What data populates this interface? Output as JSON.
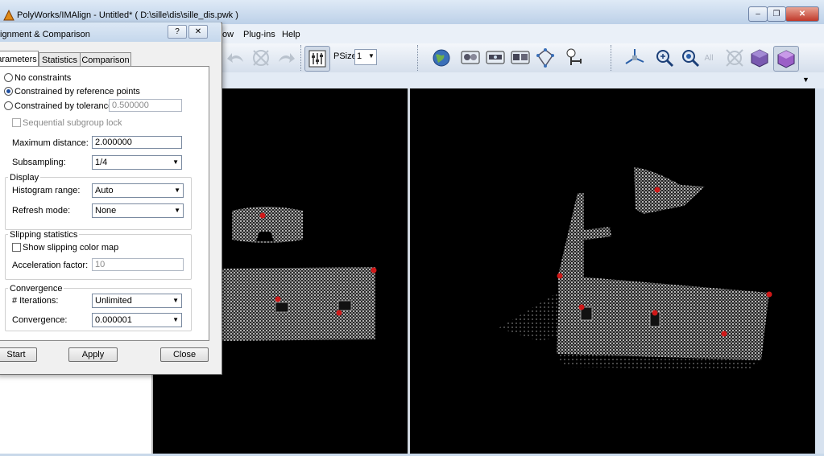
{
  "window": {
    "title": "PolyWorks/IMAlign - Untitled* ( D:\\sille\\dis\\sille_dis.pwk )",
    "minimize_glyph": "‒",
    "restore_glyph": "❐",
    "close_glyph": "✕"
  },
  "menu": {
    "items": [
      "ow",
      "Plug-ins",
      "Help"
    ]
  },
  "toolbar": {
    "psize_label": "PSize",
    "psize_value": "1",
    "icons": [
      "undo-icon",
      "align-icon",
      "redo-icon",
      "toggle-panel-icon",
      "globe-icon",
      "compare-icon",
      "scanner-icon",
      "scanner-multi-icon",
      "network-icon",
      "pivot-icon",
      "axes-icon",
      "zoom-icon",
      "zoom-out-icon",
      "zoom-all-icon",
      "disabled-tool-icon",
      "cube-shaded-icon",
      "cube-purple-icon"
    ],
    "zoom_all_label": "All"
  },
  "dialog": {
    "title": "ignment & Comparison",
    "help_glyph": "?",
    "close_glyph": "✕",
    "tabs": [
      "arameters",
      "Statistics",
      "Comparison"
    ],
    "constraints": {
      "options": [
        "No constraints",
        "Constrained by reference points",
        "Constrained by tolerance"
      ],
      "selected_index": 1,
      "tolerance_value": "0.500000"
    },
    "sequential_lock_label": "Sequential subgroup lock",
    "max_distance_label": "Maximum distance:",
    "max_distance_value": "2.000000",
    "subsampling_label": "Subsampling:",
    "subsampling_value": "1/4",
    "display": {
      "title": "Display",
      "histogram_label": "Histogram range:",
      "histogram_value": "Auto",
      "refresh_label": "Refresh mode:",
      "refresh_value": "None"
    },
    "slipping": {
      "title": "Slipping statistics",
      "show_map_label": "Show slipping color map",
      "accel_label": "Acceleration factor:",
      "accel_value": "10"
    },
    "convergence": {
      "title": "Convergence",
      "iterations_label": "# Iterations:",
      "iterations_value": "Unlimited",
      "convergence_label": "Convergence:",
      "convergence_value": "0.000001"
    },
    "buttons": {
      "start": "Start",
      "apply": "Apply",
      "close": "Close"
    }
  },
  "colors": {
    "viewport_bg": "#000000",
    "marker": "#d01818",
    "accent": "#1e4fa0"
  }
}
